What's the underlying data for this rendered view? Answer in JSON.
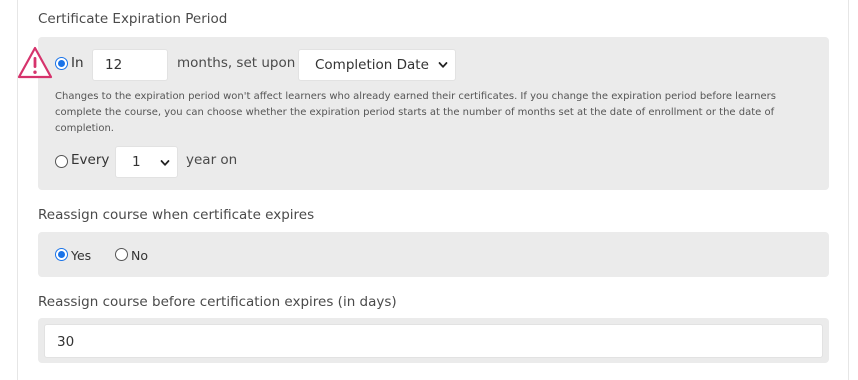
{
  "expiration": {
    "title": "Certificate Expiration Period",
    "in_label": "In",
    "months_value": "12",
    "months_set_upon": "months, set upon",
    "set_upon_selected": "Completion Date",
    "help_text": "Changes to the expiration period won't affect learners who already earned their certificates. If you change the expiration period before learners complete the course, you can choose whether the expiration period starts at the number of months set at the date of enrollment or the date of completion.",
    "every_label": "Every",
    "every_selected": "1",
    "year_on": "year on",
    "warning_icon": "warning-triangle-icon",
    "warning_color": "#d6336c"
  },
  "reassign": {
    "title": "Reassign course when certificate expires",
    "yes_label": "Yes",
    "no_label": "No",
    "selected": "Yes"
  },
  "reassign_before": {
    "title": "Reassign course before certification expires (in days)",
    "value": "30"
  },
  "colors": {
    "accent": "#1a73e8",
    "panel": "#ebebeb"
  }
}
